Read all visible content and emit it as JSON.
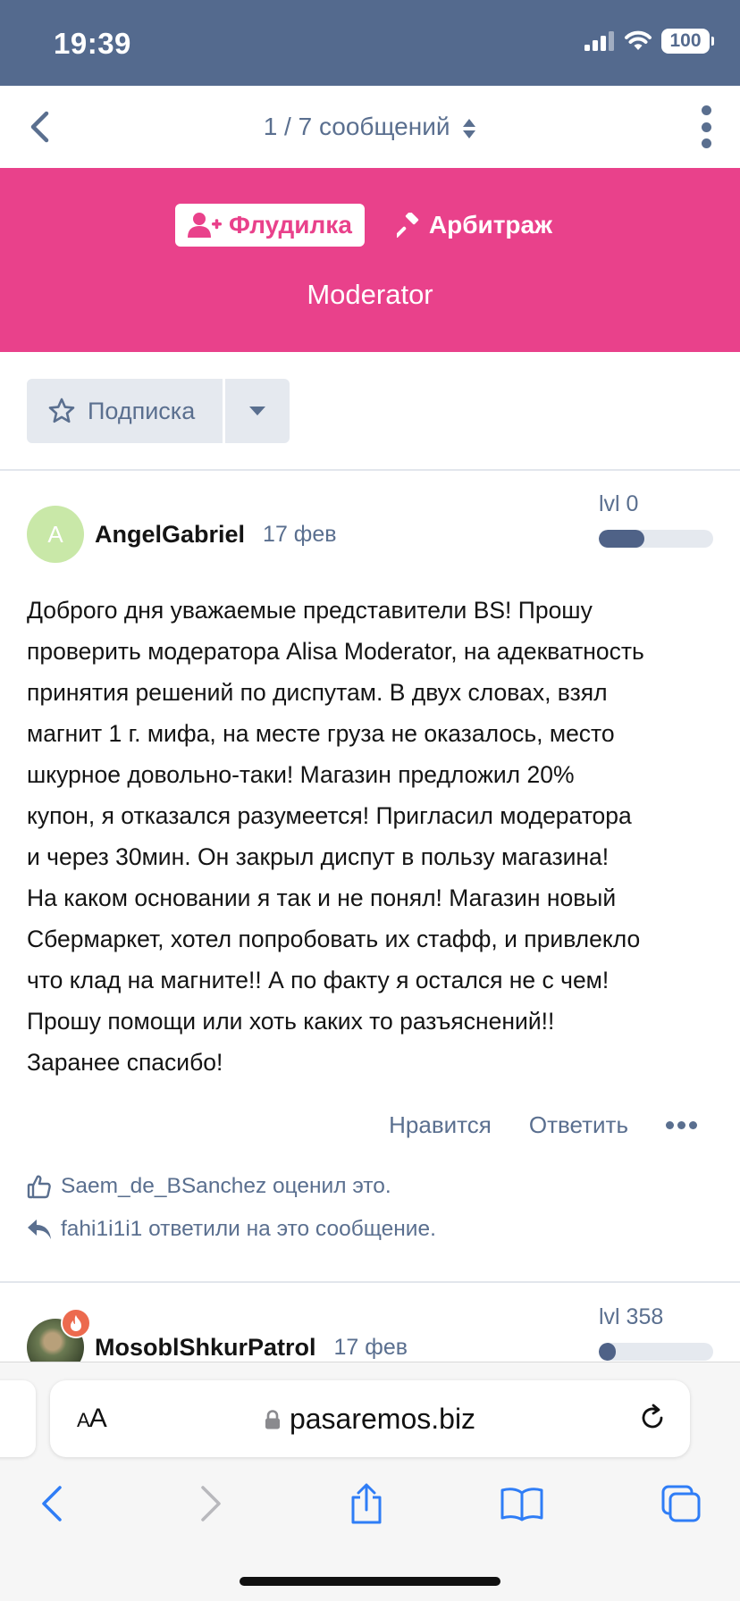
{
  "status_bar": {
    "time": "19:39",
    "battery": "100"
  },
  "thread_nav": {
    "counter": "1 / 7 сообщений"
  },
  "banner": {
    "tags": [
      {
        "label": "Флудилка",
        "icon": "user-plus-icon",
        "active": true
      },
      {
        "label": "Арбитраж",
        "icon": "gavel-icon",
        "active": false
      }
    ],
    "role": "Moderator"
  },
  "subscribe": {
    "label": "Подписка"
  },
  "post1": {
    "avatar_letter": "A",
    "username": "AngelGabriel",
    "date": "17 фев",
    "level_label": "lvl 0",
    "level_progress": 0.4,
    "body_lines": [
      "Доброго дня уважаемые представители BS! Прошу",
      "проверить модератора Alisa Moderator, на адекватность",
      "принятия решений по диспутам. В двух словах, взял",
      "магнит 1 г. мифа, на месте груза не оказалось, место",
      "шкурное довольно-таки! Магазин предложил 20%",
      "купон, я отказался разумеется! Пригласил модератора",
      "и через 30мин. Он закрыл диспут в пользу магазина!",
      "На каком основании я так и не понял! Магазин новый",
      "Сбермаркет, хотел попробовать их стафф, и привлекло",
      "что клад на магните!! А по факту я остался не с чем!",
      "Прошу помощи или хоть каких то разъяснений!!",
      "Заранее спасибо!"
    ],
    "actions": {
      "like": "Нравится",
      "reply": "Ответить"
    },
    "reactions": {
      "liked": "Saem_de_BSanchez оценил это.",
      "replied": "fahi1i1i1 ответили на это сообщение."
    }
  },
  "post2": {
    "username": "MosoblShkurPatrol",
    "date": "17 фев",
    "level_label": "lvl 358",
    "level_progress": 0.15
  },
  "browser": {
    "aa_small": "A",
    "aa_large": "A",
    "url": "pasaremos.biz"
  },
  "colors": {
    "header": "#546a8e",
    "banner": "#e9418b",
    "muted": "#5a6f8f",
    "level_fill": "#4f6287"
  }
}
